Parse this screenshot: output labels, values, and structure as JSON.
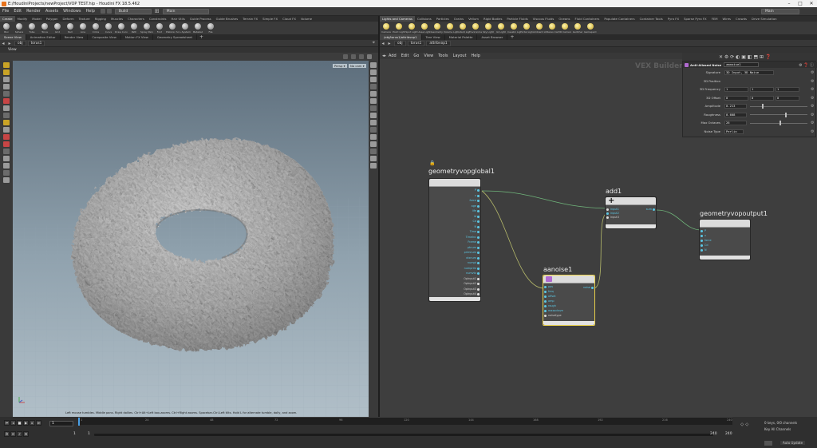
{
  "window": {
    "title": "E:/HoudiniProjects/newProject/VOP TEST.hip - Houdini FX 18.5.462",
    "controls": [
      "–",
      "□",
      "✕"
    ]
  },
  "menu": {
    "items": [
      "File",
      "Edit",
      "Render",
      "Assets",
      "Windows",
      "Help"
    ],
    "build_desk": "Build",
    "main_desk": "Main",
    "right_desk": "Main"
  },
  "shelf_left": {
    "tabs": [
      "Create",
      "Modify",
      "Model",
      "Polygon",
      "Deform",
      "Texture",
      "Rigging",
      "Muscles",
      "Characters",
      "Constraints",
      "Hair Utils",
      "Guide Process",
      "Guide Brushes",
      "Terrain FX",
      "Simple FX",
      "Cloud FX",
      "Volume"
    ],
    "tools": [
      "Box",
      "Sphere",
      "Tube",
      "Torus",
      "Grid",
      "Null",
      "Line",
      "Circle",
      "Curve",
      "Draw Curve",
      "Path",
      "Spray Paint",
      "Font",
      "Platonic Solids",
      "L-System",
      "Metaball",
      "File"
    ]
  },
  "shelf_right": {
    "tabs": [
      "Lights and Cameras",
      "Collisions",
      "Particles",
      "Grains",
      "Vellum",
      "Rigid Bodies",
      "Particle Fluids",
      "Viscous Fluids",
      "Oceans",
      "Fluid Containers",
      "Populate Containers",
      "Container Tools",
      "Pyro FX",
      "Sparse Pyro FX",
      "FEM",
      "Wires",
      "Crowds",
      "Drive Simulation"
    ],
    "tools": [
      "Camera",
      "Point Light",
      "Spot Light",
      "Area Light",
      "Geometry Light",
      "Volume Light",
      "Distant Light",
      "Environment Light",
      "Sky Light",
      "GI Light",
      "Caustic Light",
      "Portal Light",
      "Ambient Light",
      "Stereo Camera",
      "VR Camera",
      "Switcher",
      "Gamepad Camera"
    ]
  },
  "left_pane": {
    "tabs": [
      "Scene View",
      "Animation Editor",
      "Render View",
      "Composite View",
      "Motion FX View",
      "Geometry Spreadsheet"
    ],
    "path": [
      "obj",
      "torus1"
    ],
    "viewport_label": "View",
    "persp": "Persp ▾",
    "cam": "No cam ▾",
    "status_hint": "Left mouse tumbles. Middle pans. Right dollies. Ctrl+Alt+Left box-zooms. Ctrl+Right zooms. Spacebar-Ctrl-Left tilts. Hold L for alternate tumble, dolly, and zoom."
  },
  "right_pane": {
    "tabs": [
      "/obj/torus1/attribvop1",
      "Tree View",
      "Material Palette",
      "Asset Browser"
    ],
    "path": [
      "obj",
      "torus1",
      "attribvop1"
    ],
    "menu": [
      "Add",
      "Edit",
      "Go",
      "View",
      "Tools",
      "Layout",
      "Help"
    ],
    "context_label": "VEX Builder"
  },
  "params": {
    "node_type": "Anti-Aliased Noise",
    "node_name": "aanoise1",
    "rows": [
      {
        "label": "Signature",
        "value": "3D Input, 3D Noise"
      },
      {
        "label": "3D Position",
        "value": ""
      },
      {
        "label": "3D Frequency",
        "values": [
          "1",
          "1",
          "1"
        ]
      },
      {
        "label": "3D Offset",
        "values": [
          "0",
          "0",
          "0"
        ]
      },
      {
        "label": "Amplitude",
        "value": "0.213",
        "fraction": 0.21
      },
      {
        "label": "Roughness",
        "value": "0.608",
        "fraction": 0.61
      },
      {
        "label": "Max Octaves",
        "value": "26",
        "fraction": 0.52
      },
      {
        "label": "Noise Type",
        "value": "Perlin"
      }
    ]
  },
  "nodes": {
    "global": {
      "name": "geometryvopglobal1",
      "outputs": [
        "P",
        "v",
        "force",
        "age",
        "life",
        "id",
        "Cd",
        "N",
        "Time",
        "TimeInc",
        "Frame",
        "ptnum",
        "primnum",
        "vtxnum",
        "numpt",
        "numprim",
        "numvtx",
        "OpInput1",
        "OpInput2",
        "OpInput3",
        "OpInput4"
      ]
    },
    "add": {
      "name": "add1",
      "inputs": [
        "input1",
        "input2",
        "input3"
      ],
      "output": "sum"
    },
    "aanoise": {
      "name": "aanoise1",
      "inputs": [
        "pos",
        "freq",
        "offset",
        "amp",
        "rough",
        "maxoctave",
        "noisetype"
      ],
      "output": "noise"
    },
    "output": {
      "name": "geometryvopoutput1",
      "inputs": [
        "P",
        "v",
        "force",
        "Cd",
        "N"
      ]
    }
  },
  "timeline": {
    "ticks": [
      "1",
      "24",
      "48",
      "72",
      "96",
      "120",
      "144",
      "168",
      "192",
      "216",
      "240"
    ],
    "current_frame": "1",
    "start": "1",
    "start2": "1",
    "end": "240",
    "end2": "240",
    "keys_label": "0 keys, 0/0 channels",
    "channels_label": "Key All Channels",
    "auto_update": "Auto Update"
  }
}
